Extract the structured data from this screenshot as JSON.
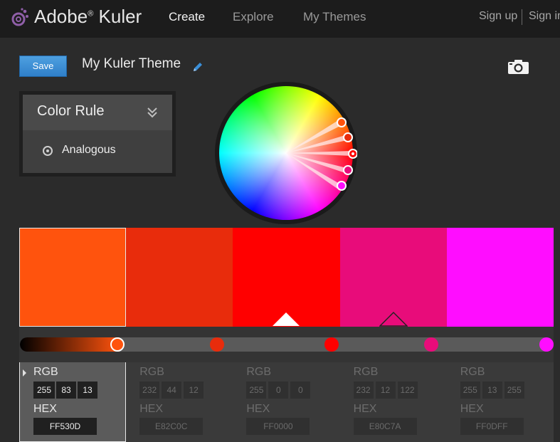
{
  "app": {
    "logo": "Adobe",
    "logo_reg": "®",
    "logo_product": " Kuler",
    "nav": [
      "Create",
      "Explore",
      "My Themes"
    ],
    "auth": {
      "sign_up": "Sign up",
      "sign_in": "Sign in"
    }
  },
  "toolbar": {
    "save_label": "Save",
    "theme_name": "My Kuler Theme",
    "edit_icon": "pencil-icon",
    "camera_icon": "camera-icon"
  },
  "color_rule": {
    "title": "Color Rule",
    "selected": "Analogous",
    "expand_icon": "chevron-double-down-icon"
  },
  "colors": [
    {
      "rgb": [
        "255",
        "83",
        "13"
      ],
      "hex": "FF530D",
      "color": "#FF530D",
      "selected": true
    },
    {
      "rgb": [
        "232",
        "44",
        "12"
      ],
      "hex": "E82C0C",
      "color": "#E82C0C",
      "selected": false
    },
    {
      "rgb": [
        "255",
        "0",
        "0"
      ],
      "hex": "FF0000",
      "color": "#FF0000",
      "selected": false
    },
    {
      "rgb": [
        "232",
        "12",
        "122"
      ],
      "hex": "E80C7A",
      "color": "#E80C7A",
      "selected": false
    },
    {
      "rgb": [
        "255",
        "13",
        "255"
      ],
      "hex": "FF0DFF",
      "color": "#FF0DFF",
      "selected": false
    }
  ],
  "labels": {
    "rgb": "RGB",
    "hex": "HEX"
  },
  "base_color_index": 2,
  "selected_brightness": 0.18
}
